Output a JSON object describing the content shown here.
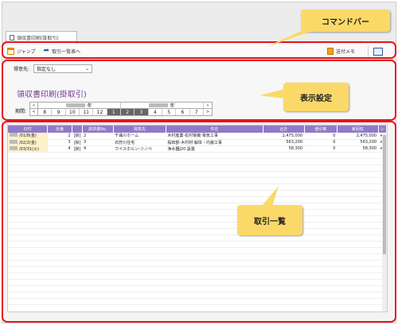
{
  "window": {
    "tab_label": "領収書印刷(掛取引)"
  },
  "command_bar": {
    "jump_label": "ジャンプ",
    "list_label": "取引一覧表へ",
    "memo_label": "送付メモ"
  },
  "settings": {
    "destination_label": "得意先:",
    "destination_value": "指定なし",
    "page_heading": "領収書印刷(掛取引)",
    "period_label": "期間:",
    "year_left": "年",
    "year_right": "年",
    "prev_year": "«",
    "next_year": "»",
    "prev_month": "<",
    "next_month": ">",
    "months": [
      "8",
      "9",
      "10",
      "11",
      "12",
      "1",
      "2",
      "3",
      "4",
      "5",
      "6",
      "7"
    ],
    "selected_months": [
      "1",
      "2",
      "3"
    ]
  },
  "table": {
    "headers": [
      "日付",
      "伝番",
      "",
      "請求書No.",
      "得意先",
      "件名",
      "合計",
      "値引等",
      "実回収",
      "レ"
    ],
    "rows": [
      [
        "/01/8(金)",
        "2",
        "[掛]",
        "2",
        "千曲川ホーム",
        "木村産業-松村電機  電気工事",
        "2,475,000",
        "0",
        "2,475,000",
        "✔"
      ],
      [
        "/02/2(金)",
        "3",
        "[掛]",
        "3",
        "石狩川住宅",
        "桜田部-木村材  解体・内装工事",
        "563,200",
        "0",
        "563,200",
        "✔"
      ],
      [
        "/03/31(火)",
        "4",
        "[掛]",
        "4",
        "ワイスホルン-ツノベ",
        "浄水器J20  設置",
        "58,300",
        "0",
        "58,300",
        "✔"
      ]
    ]
  },
  "annotations": {
    "command_bar": "コマンドバー",
    "display_settings": "表示設定",
    "transaction_list": "取引一覧"
  },
  "colors": {
    "annotation_frame": "#e8141c",
    "callout": "#fbd969",
    "table_header": "#8e7bc8",
    "heading": "#7a3c9a"
  }
}
